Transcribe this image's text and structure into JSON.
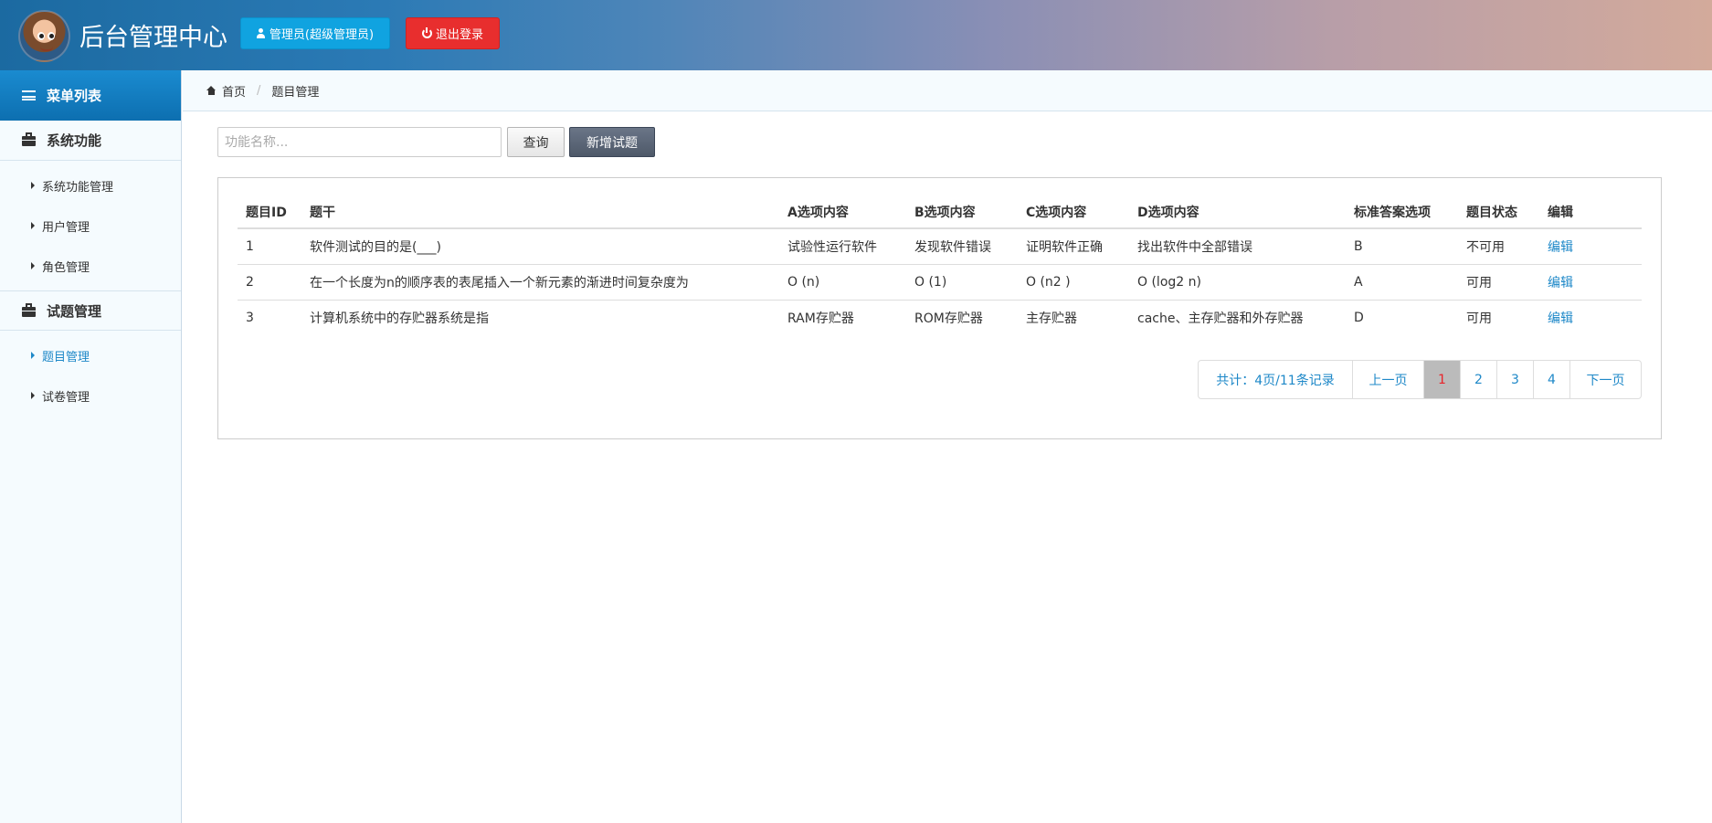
{
  "header": {
    "title": "后台管理中心",
    "admin_label": "管理员(超级管理员)",
    "logout_label": "退出登录",
    "admin_color": "#10a3e0",
    "logout_color": "#e82e2e"
  },
  "sidebar": {
    "menu_title": "菜单列表",
    "groups": [
      {
        "title": "系统功能",
        "items": [
          {
            "label": "系统功能管理"
          },
          {
            "label": "用户管理"
          },
          {
            "label": "角色管理"
          }
        ]
      },
      {
        "title": "试题管理",
        "items": [
          {
            "label": "题目管理",
            "active": true
          },
          {
            "label": "试卷管理"
          }
        ]
      }
    ]
  },
  "breadcrumb": {
    "home": "首页",
    "current": "题目管理"
  },
  "toolbar": {
    "search_placeholder": "功能名称...",
    "query_label": "查询",
    "add_label": "新增试题"
  },
  "table": {
    "columns": [
      "题目ID",
      "题干",
      "A选项内容",
      "B选项内容",
      "C选项内容",
      "D选项内容",
      "标准答案选项",
      "题目状态",
      "编辑"
    ],
    "rows": [
      [
        "1",
        "软件测试的目的是(___)",
        "试验性运行软件",
        "发现软件错误",
        "证明软件正确",
        "找出软件中全部错误",
        "B",
        "不可用",
        "编辑"
      ],
      [
        "2",
        "在一个长度为n的顺序表的表尾插入一个新元素的渐进时间复杂度为",
        "O (n)",
        "O (1)",
        "O (n2 )",
        "O (log2 n)",
        "A",
        "可用",
        "编辑"
      ],
      [
        "3",
        "计算机系统中的存贮器系统是指",
        "RAM存贮器",
        "ROM存贮器",
        "主存贮器",
        "cache、主存贮器和外存贮器",
        "D",
        "可用",
        "编辑"
      ]
    ]
  },
  "pagination": {
    "info": "共计：4页/11条记录",
    "prev": "上一页",
    "pages": [
      "1",
      "2",
      "3",
      "4"
    ],
    "current": "1",
    "next": "下一页"
  }
}
